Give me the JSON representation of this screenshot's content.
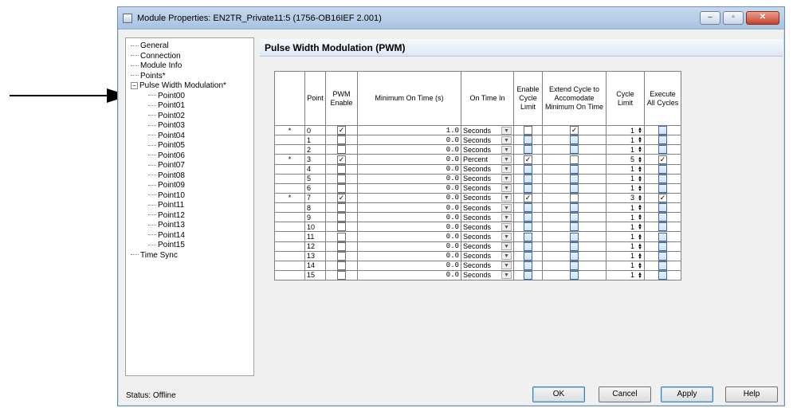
{
  "window": {
    "title": "Module Properties: EN2TR_Private11:5 (1756-OB16IEF 2.001)",
    "buttons": {
      "minimize": "–",
      "maximize": "▫",
      "close": "✕"
    }
  },
  "tree": {
    "items": [
      {
        "label": "General"
      },
      {
        "label": "Connection"
      },
      {
        "label": "Module Info"
      },
      {
        "label": "Points*"
      },
      {
        "label": "Pulse Width Modulation*"
      },
      {
        "label": "Point00"
      },
      {
        "label": "Point01"
      },
      {
        "label": "Point02"
      },
      {
        "label": "Point03"
      },
      {
        "label": "Point04"
      },
      {
        "label": "Point05"
      },
      {
        "label": "Point06"
      },
      {
        "label": "Point07"
      },
      {
        "label": "Point08"
      },
      {
        "label": "Point09"
      },
      {
        "label": "Point10"
      },
      {
        "label": "Point11"
      },
      {
        "label": "Point12"
      },
      {
        "label": "Point13"
      },
      {
        "label": "Point14"
      },
      {
        "label": "Point15"
      },
      {
        "label": "Time Sync"
      }
    ]
  },
  "panel": {
    "title": "Pulse Width Modulation (PWM)"
  },
  "table": {
    "headers": {
      "point": "Point",
      "pwm_enable": "PWM Enable",
      "min_on_time": "Minimum On Time (s)",
      "on_time_in": "On Time In",
      "enable_cycle_limit": "Enable Cycle Limit",
      "extend_cycle": "Extend Cycle to Accomodate Minimum On Time",
      "cycle_limit": "Cycle Limit",
      "execute_all": "Execute All Cycles"
    },
    "rows": [
      {
        "star": "*",
        "point": "0",
        "pwm": "✓",
        "min": "1.0",
        "unit": "Seconds",
        "ecl": "",
        "ext": "✓",
        "limit": "1",
        "exec": ""
      },
      {
        "star": "",
        "point": "1",
        "pwm": "",
        "min": "0.0",
        "unit": "Seconds",
        "ecl": "",
        "ext": "",
        "limit": "1",
        "exec": ""
      },
      {
        "star": "",
        "point": "2",
        "pwm": "",
        "min": "0.0",
        "unit": "Seconds",
        "ecl": "",
        "ext": "",
        "limit": "1",
        "exec": ""
      },
      {
        "star": "*",
        "point": "3",
        "pwm": "✓",
        "min": "0.0",
        "unit": "Percent",
        "ecl": "✓",
        "ext": "",
        "limit": "5",
        "exec": "✓"
      },
      {
        "star": "",
        "point": "4",
        "pwm": "",
        "min": "0.0",
        "unit": "Seconds",
        "ecl": "",
        "ext": "",
        "limit": "1",
        "exec": ""
      },
      {
        "star": "",
        "point": "5",
        "pwm": "",
        "min": "0.0",
        "unit": "Seconds",
        "ecl": "",
        "ext": "",
        "limit": "1",
        "exec": ""
      },
      {
        "star": "",
        "point": "6",
        "pwm": "",
        "min": "0.0",
        "unit": "Seconds",
        "ecl": "",
        "ext": "",
        "limit": "1",
        "exec": ""
      },
      {
        "star": "*",
        "point": "7",
        "pwm": "✓",
        "min": "0.0",
        "unit": "Seconds",
        "ecl": "✓",
        "ext": "",
        "limit": "3",
        "exec": "✓"
      },
      {
        "star": "",
        "point": "8",
        "pwm": "",
        "min": "0.0",
        "unit": "Seconds",
        "ecl": "",
        "ext": "",
        "limit": "1",
        "exec": ""
      },
      {
        "star": "",
        "point": "9",
        "pwm": "",
        "min": "0.0",
        "unit": "Seconds",
        "ecl": "",
        "ext": "",
        "limit": "1",
        "exec": ""
      },
      {
        "star": "",
        "point": "10",
        "pwm": "",
        "min": "0.0",
        "unit": "Seconds",
        "ecl": "",
        "ext": "",
        "limit": "1",
        "exec": ""
      },
      {
        "star": "",
        "point": "11",
        "pwm": "",
        "min": "0.0",
        "unit": "Seconds",
        "ecl": "",
        "ext": "",
        "limit": "1",
        "exec": ""
      },
      {
        "star": "",
        "point": "12",
        "pwm": "",
        "min": "0.0",
        "unit": "Seconds",
        "ecl": "",
        "ext": "",
        "limit": "1",
        "exec": ""
      },
      {
        "star": "",
        "point": "13",
        "pwm": "",
        "min": "0.0",
        "unit": "Seconds",
        "ecl": "",
        "ext": "",
        "limit": "1",
        "exec": ""
      },
      {
        "star": "",
        "point": "14",
        "pwm": "",
        "min": "0.0",
        "unit": "Seconds",
        "ecl": "",
        "ext": "",
        "limit": "1",
        "exec": ""
      },
      {
        "star": "",
        "point": "15",
        "pwm": "",
        "min": "0.0",
        "unit": "Seconds",
        "ecl": "",
        "ext": "",
        "limit": "1",
        "exec": ""
      }
    ]
  },
  "status": "Status:  Offline",
  "footer": {
    "ok": "OK",
    "cancel": "Cancel",
    "apply": "Apply",
    "help": "Help"
  },
  "icons": {
    "dropdown": "chevron-down-icon",
    "spinner": "spinner-icon",
    "arrow": "pointer-arrow-icon"
  }
}
